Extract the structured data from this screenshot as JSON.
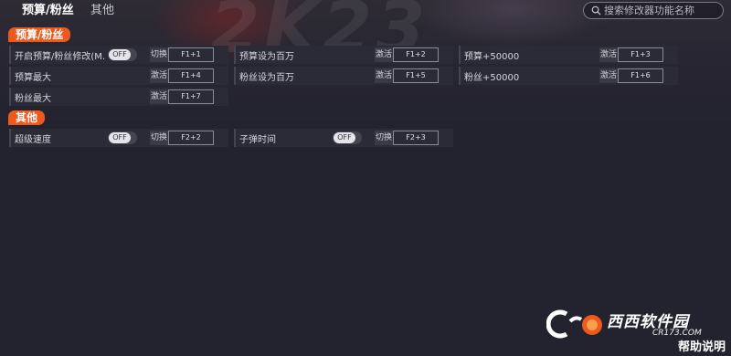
{
  "tabs": [
    {
      "label": "预算/粉丝",
      "active": true
    },
    {
      "label": "其他",
      "active": false
    }
  ],
  "search": {
    "placeholder": "搜索修改器功能名称",
    "value": ""
  },
  "sections": [
    {
      "title": "预算/粉丝",
      "rows": [
        {
          "label": "开启预算/粉丝修改(M...",
          "toggle": "OFF",
          "action": "切换",
          "hotkey": "F1+1"
        },
        {
          "label": "预算设为百万",
          "action": "激活",
          "hotkey": "F1+2"
        },
        {
          "label": "预算+50000",
          "action": "激活",
          "hotkey": "F1+3"
        },
        {
          "label": "预算最大",
          "action": "激活",
          "hotkey": "F1+4"
        },
        {
          "label": "粉丝设为百万",
          "action": "激活",
          "hotkey": "F1+5"
        },
        {
          "label": "粉丝+50000",
          "action": "激活",
          "hotkey": "F1+6"
        },
        {
          "label": "粉丝最大",
          "action": "激活",
          "hotkey": "F1+7"
        }
      ]
    },
    {
      "title": "其他",
      "rows": [
        {
          "label": "超级速度",
          "toggle": "OFF",
          "action": "切换",
          "hotkey": "F2+2"
        },
        {
          "label": "子弹时间",
          "toggle": "OFF",
          "action": "切换",
          "hotkey": "F2+3"
        }
      ]
    }
  ],
  "help_label": "帮助说明",
  "watermark": {
    "brand": "西西软件园",
    "domain": "CR173.COM"
  },
  "colors": {
    "accent": "#ee5a1e",
    "background": "#23232f",
    "row": "#2b2b37"
  }
}
